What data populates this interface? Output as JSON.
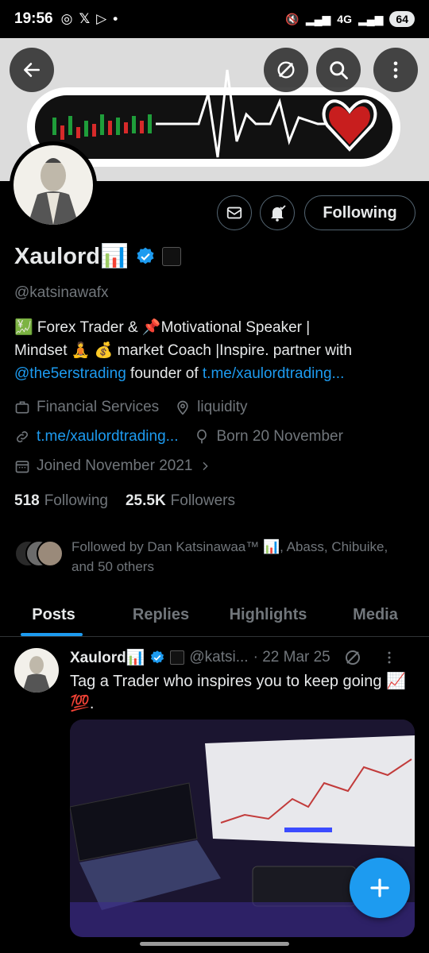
{
  "status_bar": {
    "time": "19:56",
    "battery": "64",
    "network": "4G"
  },
  "header": {
    "back_icon": "arrow-left-icon",
    "grok_icon": "grok-icon",
    "search_icon": "search-icon",
    "more_icon": "more-vertical-icon"
  },
  "profile": {
    "name": "Xaulord📊",
    "handle": "@katsinawafx",
    "follow_label": "Following",
    "bio": {
      "line1": "💹 Forex Trader & 📌Motivational Speaker |",
      "line2": "Mindset 🧘 💰 market Coach |Inspire. partner with",
      "mention": "@the5erstrading",
      "middle": " founder of ",
      "url": "t.me/xaulordtrading..."
    },
    "category": "Financial Services",
    "location": "liquidity",
    "website": "t.me/xaulordtrading...",
    "born": "Born 20 November",
    "joined": "Joined November 2021",
    "following_count": "518",
    "following_label": "Following",
    "followers_count": "25.5K",
    "followers_label": "Followers",
    "followed_by": "Followed by Dan Katsinawaa™ 📊, Abass, Chibuike, and 50 others"
  },
  "tabs": [
    {
      "label": "Posts",
      "active": true
    },
    {
      "label": "Replies",
      "active": false
    },
    {
      "label": "Highlights",
      "active": false
    },
    {
      "label": "Media",
      "active": false
    }
  ],
  "post": {
    "name": "Xaulord📊",
    "handle": "@katsi...",
    "date": "· 22 Mar 25",
    "text": "Tag a Trader who inspires you to keep going 📈💯."
  },
  "colors": {
    "accent": "#1d9bf0",
    "background": "#000000",
    "muted": "#71767b"
  }
}
